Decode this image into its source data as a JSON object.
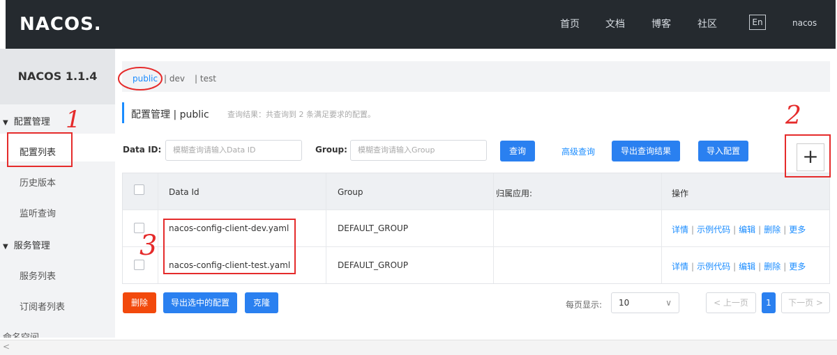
{
  "header": {
    "logo": "NACOS.",
    "nav": [
      "首页",
      "文档",
      "博客",
      "社区"
    ],
    "lang": "En",
    "user": "nacos"
  },
  "sidebar": {
    "version": "NACOS 1.1.4",
    "groups": [
      {
        "label": "配置管理",
        "items": [
          "配置列表",
          "历史版本",
          "监听查询"
        ]
      },
      {
        "label": "服务管理",
        "items": [
          "服务列表",
          "订阅者列表"
        ]
      }
    ],
    "cutoff_item": "命名空间",
    "active_item": "配置列表"
  },
  "namespace_tabs": [
    "public",
    "| dev",
    "| test"
  ],
  "breadcrumb": {
    "title": "配置管理  |  public",
    "note": "查询结果：共查询到 2 条满足要求的配置。"
  },
  "filters": {
    "dataid_label": "Data ID:",
    "dataid_placeholder": "模糊查询请输入Data ID",
    "group_label": "Group:",
    "group_placeholder": "模糊查询请输入Group",
    "query_btn": "查询",
    "advanced_link": "高级查询",
    "export_btn": "导出查询结果",
    "import_btn": "导入配置"
  },
  "plus_label": "+",
  "table": {
    "columns": [
      "Data Id",
      "Group",
      "归属应用:",
      "操作"
    ],
    "rows": [
      {
        "data_id": "nacos-config-client-dev.yaml",
        "group": "DEFAULT_GROUP",
        "app": ""
      },
      {
        "data_id": "nacos-config-client-test.yaml",
        "group": "DEFAULT_GROUP",
        "app": ""
      }
    ],
    "ops": [
      "详情",
      "示例代码",
      "编辑",
      "删除",
      "更多"
    ]
  },
  "footer": {
    "delete_btn": "删除",
    "export_selected_btn": "导出选中的配置",
    "clone_btn": "克隆",
    "page_size_label": "每页显示:",
    "page_size_value": "10",
    "prev": "< 上一页",
    "current_page": "1",
    "next": "下一页 >"
  },
  "annotations": {
    "one": "1",
    "two": "2",
    "three": "3",
    "color": "#e52b2b"
  },
  "colors": {
    "topbar": "#252a2f",
    "primary": "#2a80f0",
    "danger": "#f2490c",
    "link": "#1a8cff"
  }
}
